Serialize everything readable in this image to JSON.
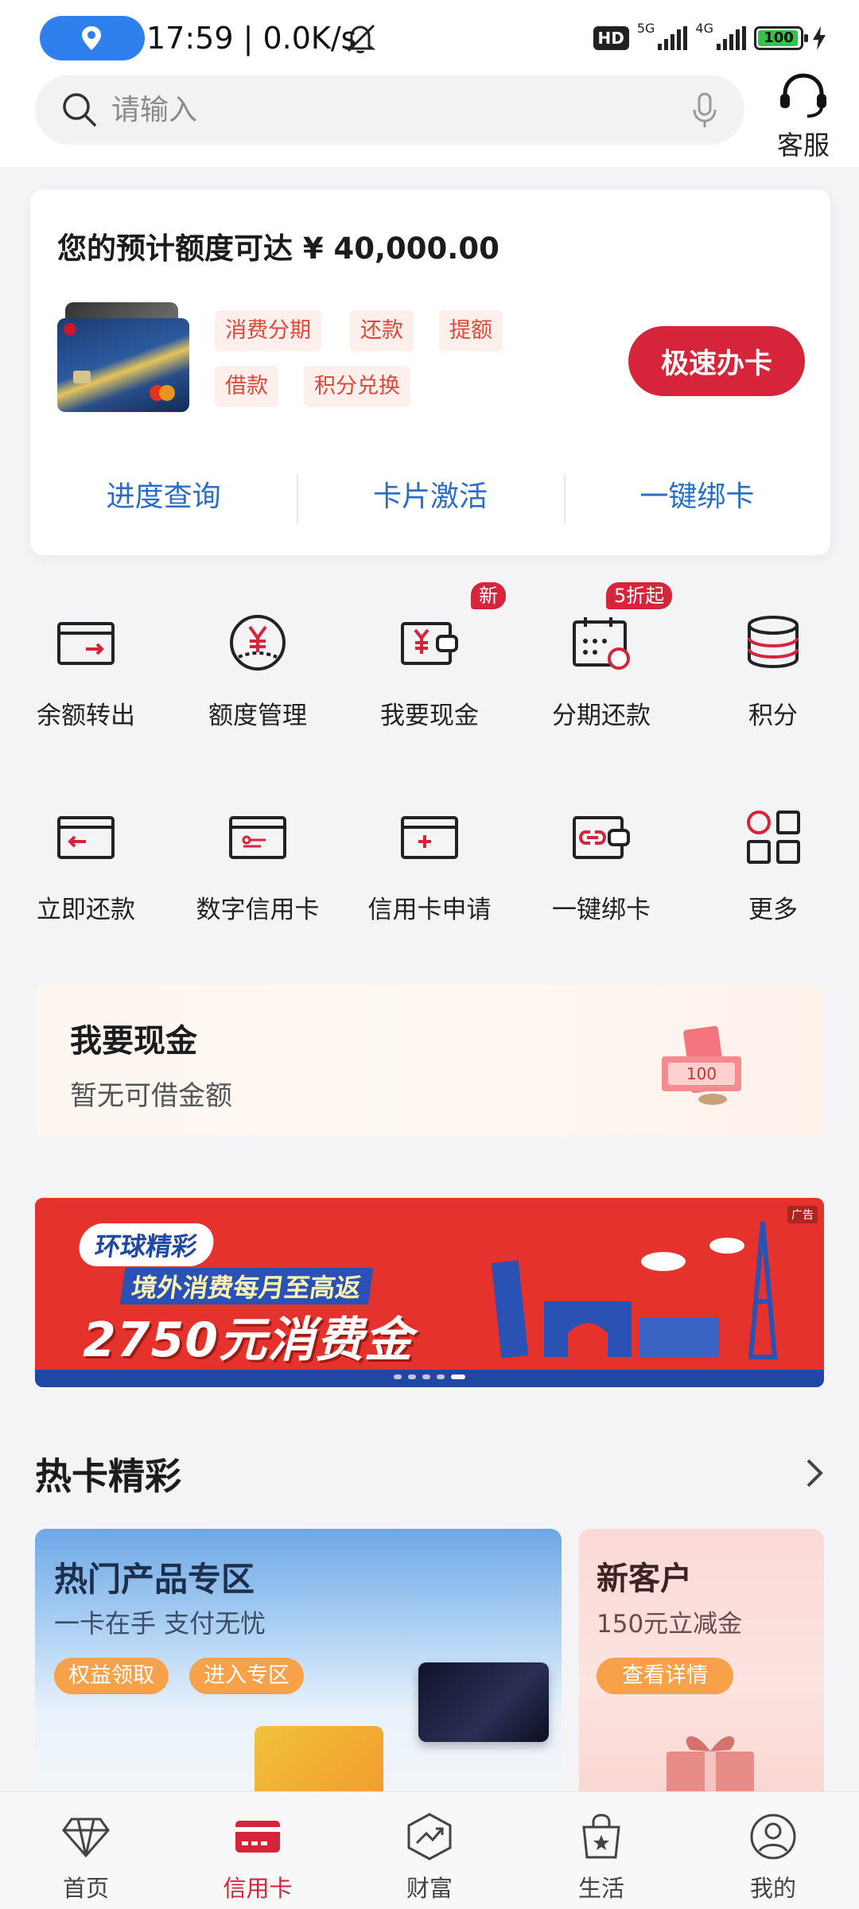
{
  "status_bar": {
    "time_speed": "17:59 | 0.0K/s",
    "hd_label": "HD",
    "net1": "5G",
    "net2": "4G",
    "battery": "100"
  },
  "header": {
    "search_placeholder": "请输入",
    "service_label": "客服"
  },
  "promo_card": {
    "title": "您的预计额度可达 ¥ 40,000.00",
    "tags": [
      "消费分期",
      "还款",
      "提额",
      "借款",
      "积分兑换"
    ],
    "apply_button": "极速办卡",
    "quick_links": [
      "进度查询",
      "卡片激活",
      "一键绑卡"
    ]
  },
  "grid": {
    "row1": [
      {
        "label": "余额转出",
        "icon": "transfer-out-icon"
      },
      {
        "label": "额度管理",
        "icon": "limit-manage-icon"
      },
      {
        "label": "我要现金",
        "icon": "cash-wallet-icon",
        "badge": "新"
      },
      {
        "label": "分期还款",
        "icon": "installment-calendar-icon",
        "badge": "5折起"
      },
      {
        "label": "积分",
        "icon": "points-stack-icon"
      }
    ],
    "row2": [
      {
        "label": "立即还款",
        "icon": "repay-card-icon"
      },
      {
        "label": "数字信用卡",
        "icon": "digital-card-icon"
      },
      {
        "label": "信用卡申请",
        "icon": "card-apply-icon"
      },
      {
        "label": "一键绑卡",
        "icon": "bind-card-icon"
      },
      {
        "label": "更多",
        "icon": "more-grid-icon"
      }
    ]
  },
  "cash_banner": {
    "title": "我要现金",
    "subtitle": "暂无可借金额",
    "money_label": "100"
  },
  "ad_banner": {
    "line1": "环球精彩",
    "line2": "境外消费每月至高返",
    "line3": "2750元消费金",
    "ad_tag": "广告",
    "slides": 5,
    "active_slide": 5
  },
  "hot_section": {
    "title": "热卡精彩",
    "main": {
      "title": "热门产品专区",
      "subtitle": "一卡在手 支付无忧",
      "btn1": "权益领取",
      "btn2": "进入专区"
    },
    "side": {
      "title": "新客户",
      "subtitle": "150元立减金",
      "btn": "查看详情"
    }
  },
  "bottom_nav": [
    {
      "label": "首页",
      "icon": "diamond-icon"
    },
    {
      "label": "信用卡",
      "icon": "credit-card-icon",
      "active": true
    },
    {
      "label": "财富",
      "icon": "wealth-chart-icon"
    },
    {
      "label": "生活",
      "icon": "shopping-bag-icon"
    },
    {
      "label": "我的",
      "icon": "user-profile-icon"
    }
  ],
  "colors": {
    "brand_red": "#d6243b",
    "link_blue": "#2a6dc7",
    "tag_bg": "#fdf0ec",
    "tag_text": "#e0483c"
  }
}
